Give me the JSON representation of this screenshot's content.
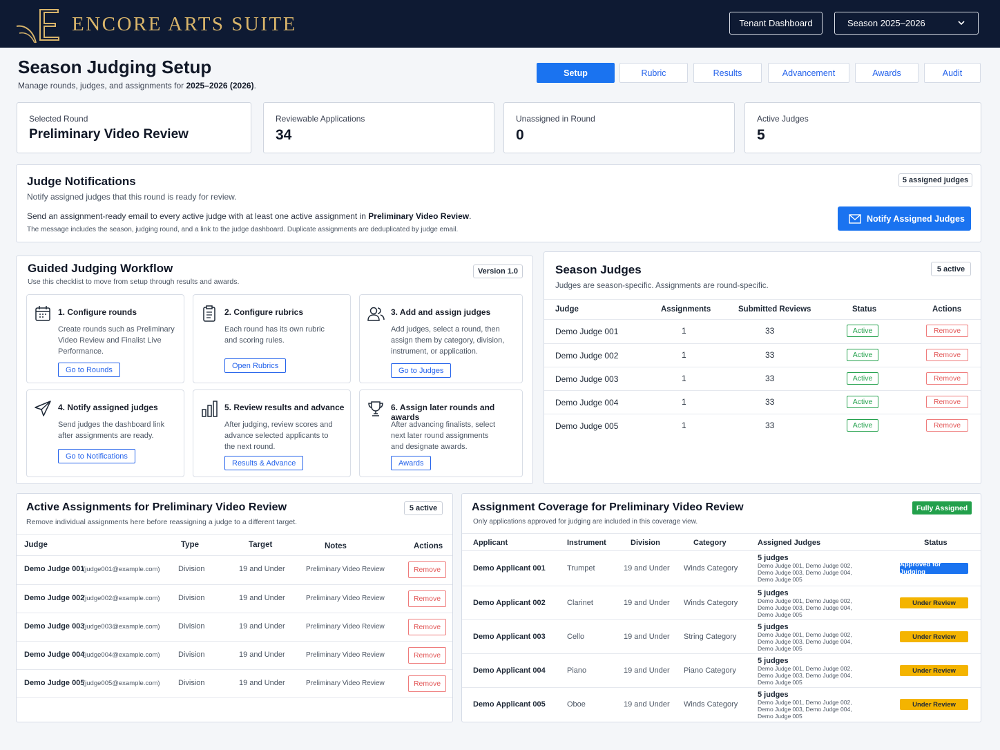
{
  "brand": {
    "name": "ENCORE ARTS SUITE",
    "colors": {
      "navy": "#0e1a33",
      "gold": "#d8b46a",
      "accent": "#1a73f0"
    }
  },
  "header": {
    "tenant_button": "Tenant Dashboard",
    "season_select": "Season 2025–2026"
  },
  "page": {
    "title": "Season Judging Setup",
    "subtitle_prefix": "Manage rounds, judges, and assignments for ",
    "subtitle_season": "2025–2026 (2026)",
    "subtitle_suffix": "."
  },
  "tabs": [
    "Setup",
    "Rubric",
    "Results",
    "Advancement",
    "Awards",
    "Audit"
  ],
  "stats": [
    {
      "label": "Selected Round",
      "value": "Preliminary Video Review"
    },
    {
      "label": "Reviewable Applications",
      "value": "34"
    },
    {
      "label": "Unassigned in Round",
      "value": "0"
    },
    {
      "label": "Active Judges",
      "value": "5"
    }
  ],
  "notifications": {
    "title": "Judge Notifications",
    "subtitle": "Notify assigned judges that this round is ready for review.",
    "body_prefix": "Send an assignment-ready email to every active judge with at least one active assignment in ",
    "body_round": "Preliminary Video Review",
    "body_suffix": ".",
    "note": "The message includes the season, judging round, and a link to the judge dashboard. Duplicate assignments are deduplicated by judge email.",
    "badge": "5 assigned judges",
    "button": "Notify Assigned Judges"
  },
  "workflow": {
    "title": "Guided Judging Workflow",
    "subtitle": "Use this checklist to move from setup through results and awards.",
    "version": "Version 1.0",
    "steps": [
      {
        "title": "1. Configure rounds",
        "desc": [
          "Create rounds such as Preliminary",
          "Video Review and Finalist Live",
          "Performance."
        ],
        "button": "Go to Rounds",
        "icon": "calendar-icon"
      },
      {
        "title": "2. Configure rubrics",
        "desc": [
          "Each round has its own rubric",
          "and scoring rules."
        ],
        "button": "Open Rubrics",
        "icon": "clipboard-icon"
      },
      {
        "title": "3. Add and assign judges",
        "desc": [
          "Add judges, select a round, then",
          "assign them by category, division,",
          "instrument, or application."
        ],
        "button": "Go to Judges",
        "icon": "users-icon"
      },
      {
        "title": "4. Notify assigned judges",
        "desc": [
          "Send judges the dashboard link",
          "after assignments are ready."
        ],
        "button": "Go to Notifications",
        "icon": "send-icon"
      },
      {
        "title": "5. Review results and advance",
        "desc": [
          "After judging, review scores and",
          "advance selected applicants to",
          "the next round."
        ],
        "button": "Results & Advance",
        "icon": "bar-chart-icon"
      },
      {
        "title": "6. Assign later rounds and awards",
        "desc": [
          "After advancing finalists, select",
          "next later round assignments",
          "and designate awards."
        ],
        "button": "Awards",
        "icon": "trophy-icon"
      }
    ]
  },
  "season_judges": {
    "title": "Season Judges",
    "subtitle": "Judges are season-specific. Assignments are round-specific.",
    "badge": "5 active",
    "columns": [
      "Judge",
      "Assignments",
      "Submitted Reviews",
      "Status",
      "Actions"
    ],
    "rows": [
      {
        "judge": "Demo Judge 001",
        "assignments": "1",
        "submitted": "33",
        "status": "Active",
        "action": "Remove"
      },
      {
        "judge": "Demo Judge 002",
        "assignments": "1",
        "submitted": "33",
        "status": "Active",
        "action": "Remove"
      },
      {
        "judge": "Demo Judge 003",
        "assignments": "1",
        "submitted": "33",
        "status": "Active",
        "action": "Remove"
      },
      {
        "judge": "Demo Judge 004",
        "assignments": "1",
        "submitted": "33",
        "status": "Active",
        "action": "Remove"
      },
      {
        "judge": "Demo Judge 005",
        "assignments": "1",
        "submitted": "33",
        "status": "Active",
        "action": "Remove"
      }
    ]
  },
  "active_assignments": {
    "title": "Active Assignments for Preliminary Video Review",
    "subtitle": "Remove individual assignments here before reassigning a judge to a different target.",
    "badge": "5 active",
    "columns": [
      "Judge",
      "Type",
      "Target",
      "Notes",
      "Actions"
    ],
    "rows": [
      {
        "judge": "Demo Judge 001",
        "email": "(judge001@example.com)",
        "type": "Division",
        "target": "19 and Under",
        "notes": "Preliminary Video Review",
        "action": "Remove"
      },
      {
        "judge": "Demo Judge 002",
        "email": "(judge002@example.com)",
        "type": "Division",
        "target": "19 and Under",
        "notes": "Preliminary Video Review",
        "action": "Remove"
      },
      {
        "judge": "Demo Judge 003",
        "email": "(judge003@example.com)",
        "type": "Division",
        "target": "19 and Under",
        "notes": "Preliminary Video Review",
        "action": "Remove"
      },
      {
        "judge": "Demo Judge 004",
        "email": "(judge004@example.com)",
        "type": "Division",
        "target": "19 and Under",
        "notes": "Preliminary Video Review",
        "action": "Remove"
      },
      {
        "judge": "Demo Judge 005",
        "email": "(judge005@example.com)",
        "type": "Division",
        "target": "19 and Under",
        "notes": "Preliminary Video Review",
        "action": "Remove"
      }
    ]
  },
  "coverage": {
    "title": "Assignment Coverage for Preliminary Video Review",
    "subtitle": "Only applications approved for judging are included in this coverage view.",
    "badge": "Fully Assigned",
    "columns": [
      "Applicant",
      "Instrument",
      "Division",
      "Category",
      "Assigned Judges",
      "Status"
    ],
    "rows": [
      {
        "applicant": "Demo Applicant 001",
        "instrument": "Trumpet",
        "division": "19 and Under",
        "category": "Winds Category",
        "judges_count": "5 judges",
        "judges_list": [
          "Demo Judge 001, Demo Judge 002,",
          "Demo Judge 003, Demo Judge 004,",
          "Demo Judge 005"
        ],
        "status": "Approved for Judging"
      },
      {
        "applicant": "Demo Applicant 002",
        "instrument": "Clarinet",
        "division": "19 and Under",
        "category": "Winds Category",
        "judges_count": "5 judges",
        "judges_list": [
          "Demo Judge 001, Demo Judge 002,",
          "Demo Judge 003, Demo Judge 004,",
          "Demo Judge 005"
        ],
        "status": "Under Review"
      },
      {
        "applicant": "Demo Applicant 003",
        "instrument": "Cello",
        "division": "19 and Under",
        "category": "String Category",
        "judges_count": "5 judges",
        "judges_list": [
          "Demo Judge 001, Demo Judge 002,",
          "Demo Judge 003, Demo Judge 004,",
          "Demo Judge 005"
        ],
        "status": "Under Review"
      },
      {
        "applicant": "Demo Applicant 004",
        "instrument": "Piano",
        "division": "19 and Under",
        "category": "Piano Category",
        "judges_count": "5 judges",
        "judges_list": [
          "Demo Judge 001, Demo Judge 002,",
          "Demo Judge 003, Demo Judge 004,",
          "Demo Judge 005"
        ],
        "status": "Under Review"
      },
      {
        "applicant": "Demo Applicant 005",
        "instrument": "Oboe",
        "division": "19 and Under",
        "category": "Winds Category",
        "judges_count": "5 judges",
        "judges_list": [
          "Demo Judge 001, Demo Judge 002,",
          "Demo Judge 003, Demo Judge 004,",
          "Demo Judge 005"
        ],
        "status": "Under Review"
      }
    ]
  }
}
